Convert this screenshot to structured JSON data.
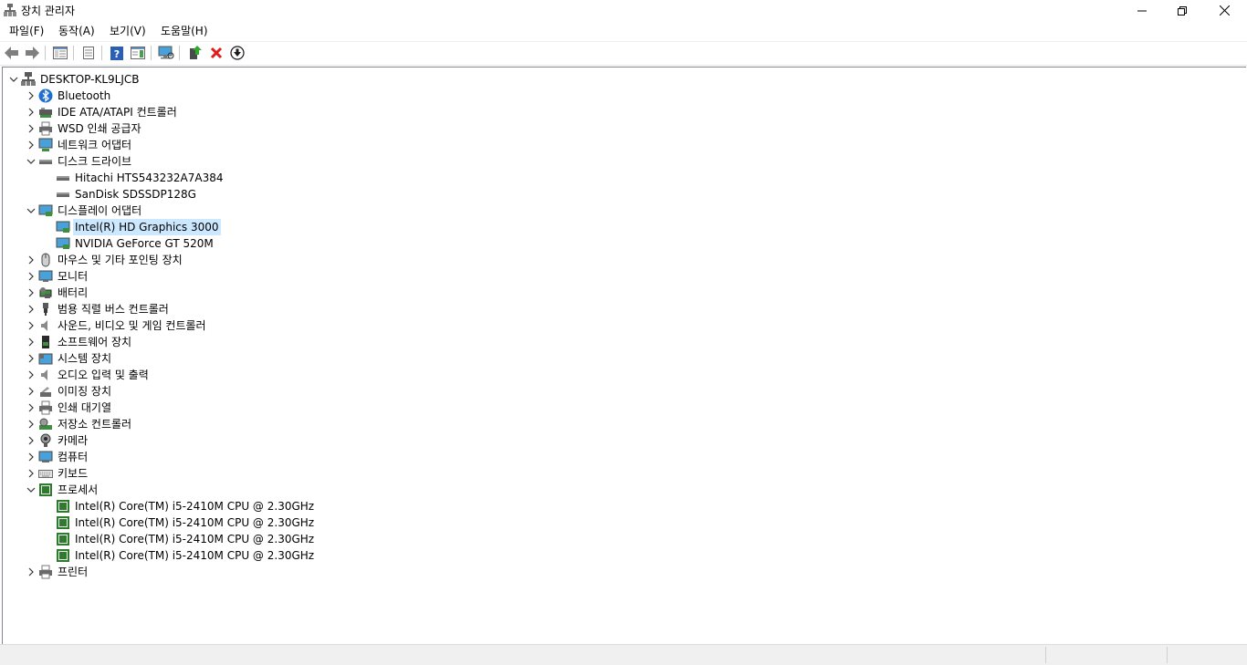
{
  "window": {
    "title": "장치 관리자"
  },
  "menu": {
    "file": "파일(F)",
    "action": "동작(A)",
    "view": "보기(V)",
    "help": "도움말(H)"
  },
  "toolbar": {
    "icons": [
      "back-arrow-icon",
      "forward-arrow-icon",
      "show-hide-console-tree-icon",
      "properties-icon",
      "help-icon",
      "action-pane-icon",
      "scan-hardware-icon",
      "update-driver-icon",
      "uninstall-icon",
      "disable-device-icon"
    ]
  },
  "tree": {
    "root": "DESKTOP-KL9LJCB",
    "categories": [
      {
        "label": "Bluetooth",
        "icon": "bluetooth-icon",
        "expanded": false
      },
      {
        "label": "IDE ATA/ATAPI 컨트롤러",
        "icon": "ide-controller-icon",
        "expanded": false
      },
      {
        "label": "WSD 인쇄 공급자",
        "icon": "printer-icon",
        "expanded": false
      },
      {
        "label": "네트워크 어댑터",
        "icon": "network-adapter-icon",
        "expanded": false
      },
      {
        "label": "디스크 드라이브",
        "icon": "disk-drive-icon",
        "expanded": true,
        "children": [
          "Hitachi HTS543232A7A384",
          "SanDisk SDSSDP128G"
        ]
      },
      {
        "label": "디스플레이 어댑터",
        "icon": "display-adapter-icon",
        "expanded": true,
        "children": [
          "Intel(R) HD Graphics 3000",
          "NVIDIA GeForce GT 520M"
        ],
        "selected_child": "Intel(R) HD Graphics 3000"
      },
      {
        "label": "마우스 및 기타 포인팅 장치",
        "icon": "mouse-icon",
        "expanded": false
      },
      {
        "label": "모니터",
        "icon": "monitor-icon",
        "expanded": false
      },
      {
        "label": "배터리",
        "icon": "battery-icon",
        "expanded": false
      },
      {
        "label": "범용 직렬 버스 컨트롤러",
        "icon": "usb-icon",
        "expanded": false
      },
      {
        "label": "사운드, 비디오 및 게임 컨트롤러",
        "icon": "speaker-icon",
        "expanded": false
      },
      {
        "label": "소프트웨어 장치",
        "icon": "software-device-icon",
        "expanded": false
      },
      {
        "label": "시스템 장치",
        "icon": "system-device-icon",
        "expanded": false
      },
      {
        "label": "오디오 입력 및 출력",
        "icon": "audio-io-icon",
        "expanded": false
      },
      {
        "label": "이미징 장치",
        "icon": "imaging-device-icon",
        "expanded": false
      },
      {
        "label": "인쇄 대기열",
        "icon": "print-queue-icon",
        "expanded": false
      },
      {
        "label": "저장소 컨트롤러",
        "icon": "storage-controller-icon",
        "expanded": false
      },
      {
        "label": "카메라",
        "icon": "camera-icon",
        "expanded": false
      },
      {
        "label": "컴퓨터",
        "icon": "computer-icon",
        "expanded": false
      },
      {
        "label": "키보드",
        "icon": "keyboard-icon",
        "expanded": false
      },
      {
        "label": "프로세서",
        "icon": "processor-icon",
        "expanded": true,
        "children": [
          "Intel(R) Core(TM) i5-2410M CPU @ 2.30GHz",
          "Intel(R) Core(TM) i5-2410M CPU @ 2.30GHz",
          "Intel(R) Core(TM) i5-2410M CPU @ 2.30GHz",
          "Intel(R) Core(TM) i5-2410M CPU @ 2.30GHz"
        ]
      },
      {
        "label": "프린터",
        "icon": "printer-icon",
        "expanded": false
      }
    ]
  },
  "colors": {
    "selection": "#cce8ff",
    "statusbar": "#f0f0f0",
    "border": "#828790"
  }
}
